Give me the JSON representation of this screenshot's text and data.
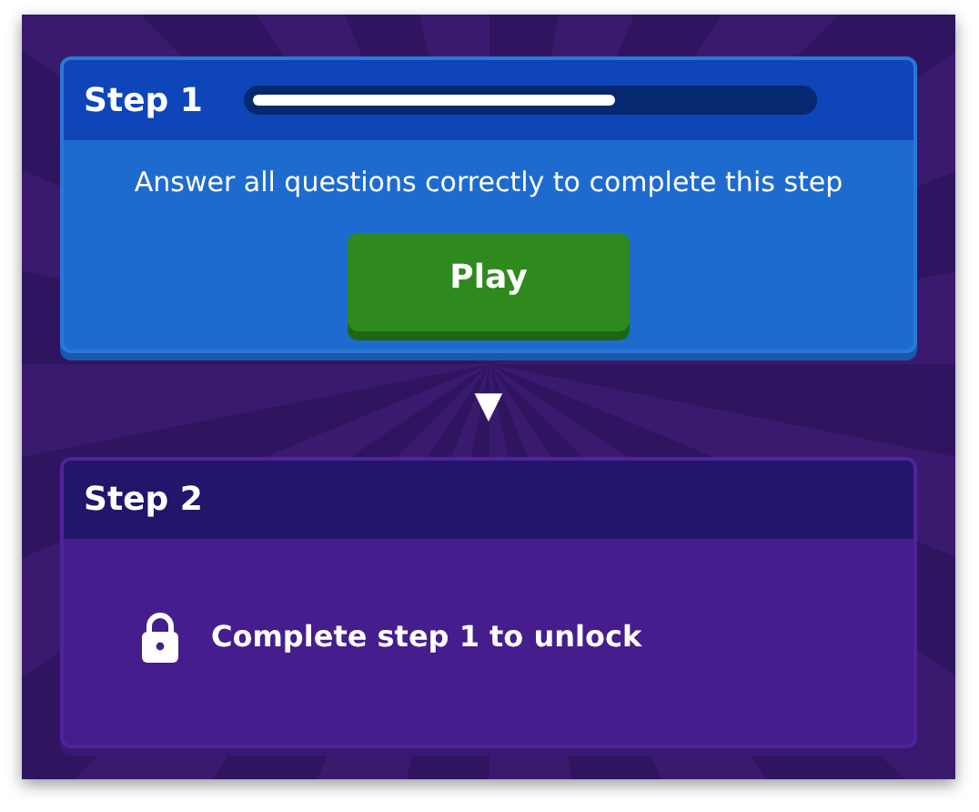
{
  "steps": [
    {
      "title": "Step 1",
      "kind": "active",
      "level": 0.65,
      "description": "Answer all questions correctly to complete this step",
      "button": "Play"
    },
    {
      "title": "Step 2",
      "kind": "locked",
      "message": "Complete step 1 to unlock"
    }
  ],
  "connector": "▼"
}
